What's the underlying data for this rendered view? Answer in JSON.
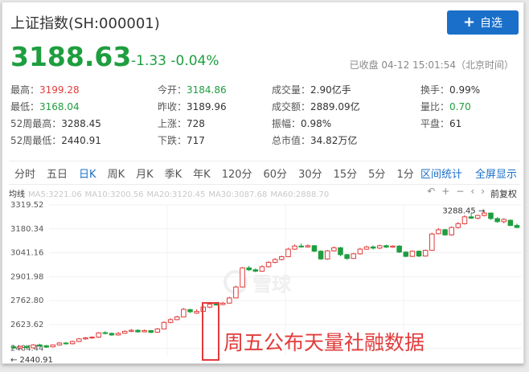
{
  "header": {
    "title": "上证指数(SH:000001)",
    "add_button": "自选",
    "price": "3188.63",
    "change": "-1.33 -0.04%",
    "status": "已收盘 04-12 15:01:54（北京时间）"
  },
  "stats": [
    {
      "label": "最高：",
      "value": "3199.28",
      "color": "red"
    },
    {
      "label": "今开：",
      "value": "3184.86",
      "color": "green"
    },
    {
      "label": "成交量：",
      "value": "2.90亿手",
      "color": ""
    },
    {
      "label": "换手：",
      "value": "0.99%",
      "color": ""
    },
    {
      "label": "最低：",
      "value": "3168.04",
      "color": "green"
    },
    {
      "label": "昨收：",
      "value": "3189.96",
      "color": ""
    },
    {
      "label": "成交额：",
      "value": "2889.09亿",
      "color": ""
    },
    {
      "label": "量比：",
      "value": "0.70",
      "color": "green"
    },
    {
      "label": "52周最高：",
      "value": "3288.45",
      "color": ""
    },
    {
      "label": "上涨：",
      "value": "728",
      "color": ""
    },
    {
      "label": "振幅：",
      "value": "0.98%",
      "color": ""
    },
    {
      "label": "平盘：",
      "value": "61",
      "color": ""
    },
    {
      "label": "52周最低：",
      "value": "2440.91",
      "color": ""
    },
    {
      "label": "下跌：",
      "value": "717",
      "color": ""
    },
    {
      "label": "总市值：",
      "value": "34.82万亿",
      "color": ""
    }
  ],
  "tabs": [
    "分时",
    "五日",
    "日K",
    "周K",
    "月K",
    "季K",
    "年K",
    "120分",
    "60分",
    "30分",
    "15分",
    "5分",
    "1分"
  ],
  "active_tab": "日K",
  "tab_links": [
    "区间统计",
    "全屏显示"
  ],
  "legend": {
    "label": "均线",
    "ma": [
      "MA5:3221.06",
      "MA10:3200.56",
      "MA20:3120.45",
      "MA30:3087.68",
      "MA60:2888.70"
    ]
  },
  "controls": [
    "↶",
    "+",
    "−",
    "‹",
    "›"
  ],
  "adjust": "前复权",
  "annotation": "周五公布天量社融数据",
  "watermark": "雪球",
  "chart_data": {
    "type": "candlestick",
    "y_ticks": [
      "3319.52",
      "3180.34",
      "3041.16",
      "2901.98",
      "2762.80",
      "2623.62",
      "2484.44"
    ],
    "ylim": [
      2440.91,
      3319.52
    ],
    "max_label": "3288.45",
    "min_label": "2440.91",
    "up_color": "#e23b3b",
    "down_color": "#1e9e3f",
    "candles": [
      [
        2494,
        2487,
        2505,
        2482
      ],
      [
        2487,
        2496,
        2500,
        2480
      ],
      [
        2496,
        2490,
        2505,
        2485
      ],
      [
        2488,
        2505,
        2510,
        2484
      ],
      [
        2505,
        2498,
        2512,
        2494
      ],
      [
        2500,
        2492,
        2505,
        2488
      ],
      [
        2494,
        2505,
        2508,
        2490
      ],
      [
        2505,
        2516,
        2522,
        2501
      ],
      [
        2516,
        2513,
        2522,
        2507
      ],
      [
        2512,
        2525,
        2530,
        2508
      ],
      [
        2525,
        2540,
        2545,
        2521
      ],
      [
        2540,
        2546,
        2551,
        2535
      ],
      [
        2546,
        2550,
        2555,
        2541
      ],
      [
        2550,
        2575,
        2580,
        2545
      ],
      [
        2576,
        2572,
        2585,
        2566
      ],
      [
        2572,
        2563,
        2578,
        2558
      ],
      [
        2563,
        2572,
        2580,
        2559
      ],
      [
        2573,
        2584,
        2590,
        2569
      ],
      [
        2584,
        2590,
        2598,
        2579
      ],
      [
        2590,
        2581,
        2596,
        2576
      ],
      [
        2581,
        2588,
        2595,
        2578
      ],
      [
        2588,
        2578,
        2592,
        2573
      ],
      [
        2579,
        2598,
        2604,
        2575
      ],
      [
        2598,
        2636,
        2642,
        2596
      ],
      [
        2636,
        2652,
        2660,
        2630
      ],
      [
        2652,
        2668,
        2675,
        2648
      ],
      [
        2668,
        2712,
        2720,
        2665
      ],
      [
        2710,
        2698,
        2716,
        2690
      ],
      [
        2690,
        2700,
        2712,
        2685
      ],
      [
        2700,
        2725,
        2734,
        2698
      ],
      [
        2725,
        2742,
        2750,
        2718
      ],
      [
        2742,
        2740,
        2752,
        2733
      ],
      [
        2740,
        2748,
        2755,
        2735
      ],
      [
        2748,
        2778,
        2785,
        2746
      ],
      [
        2778,
        2842,
        2850,
        2776
      ],
      [
        2842,
        2953,
        2958,
        2840
      ],
      [
        2953,
        2942,
        2965,
        2935
      ],
      [
        2942,
        2934,
        2950,
        2928
      ],
      [
        2934,
        2960,
        2968,
        2930
      ],
      [
        2960,
        2985,
        2992,
        2955
      ],
      [
        2985,
        3002,
        3010,
        2980
      ],
      [
        3002,
        3018,
        3024,
        2996
      ],
      [
        3018,
        3062,
        3070,
        3015
      ],
      [
        3062,
        3080,
        3090,
        3058
      ],
      [
        3080,
        3075,
        3095,
        3070
      ],
      [
        3075,
        3082,
        3090,
        3070
      ],
      [
        3082,
        3050,
        3086,
        3045
      ],
      [
        3050,
        3005,
        3055,
        3000
      ],
      [
        3005,
        3052,
        3058,
        3000
      ],
      [
        3052,
        3070,
        3078,
        3048
      ],
      [
        3070,
        3030,
        3075,
        3020
      ],
      [
        3030,
        3008,
        3035,
        3000
      ],
      [
        3008,
        3035,
        3040,
        3005
      ],
      [
        3035,
        3062,
        3070,
        3030
      ],
      [
        3062,
        3075,
        3082,
        3058
      ],
      [
        3075,
        3068,
        3084,
        3060
      ],
      [
        3068,
        3082,
        3088,
        3062
      ],
      [
        3082,
        3074,
        3088,
        3068
      ],
      [
        3074,
        3080,
        3085,
        3070
      ],
      [
        3080,
        3045,
        3085,
        3040
      ],
      [
        3045,
        3020,
        3050,
        3015
      ],
      [
        3020,
        3050,
        3055,
        3016
      ],
      [
        3050,
        3022,
        3055,
        3016
      ],
      [
        3022,
        3055,
        3060,
        3018
      ],
      [
        3055,
        3150,
        3158,
        3052
      ],
      [
        3152,
        3175,
        3185,
        3148
      ],
      [
        3175,
        3145,
        3180,
        3140
      ],
      [
        3145,
        3188,
        3195,
        3140
      ],
      [
        3188,
        3210,
        3220,
        3182
      ],
      [
        3210,
        3250,
        3260,
        3205
      ],
      [
        3250,
        3242,
        3272,
        3238
      ],
      [
        3242,
        3258,
        3262,
        3235
      ],
      [
        3258,
        3272,
        3280,
        3252
      ],
      [
        3272,
        3240,
        3275,
        3232
      ],
      [
        3240,
        3222,
        3248,
        3215
      ],
      [
        3222,
        3235,
        3242,
        3212
      ],
      [
        3230,
        3200,
        3235,
        3195
      ],
      [
        3200,
        3188,
        3210,
        3185
      ]
    ]
  }
}
